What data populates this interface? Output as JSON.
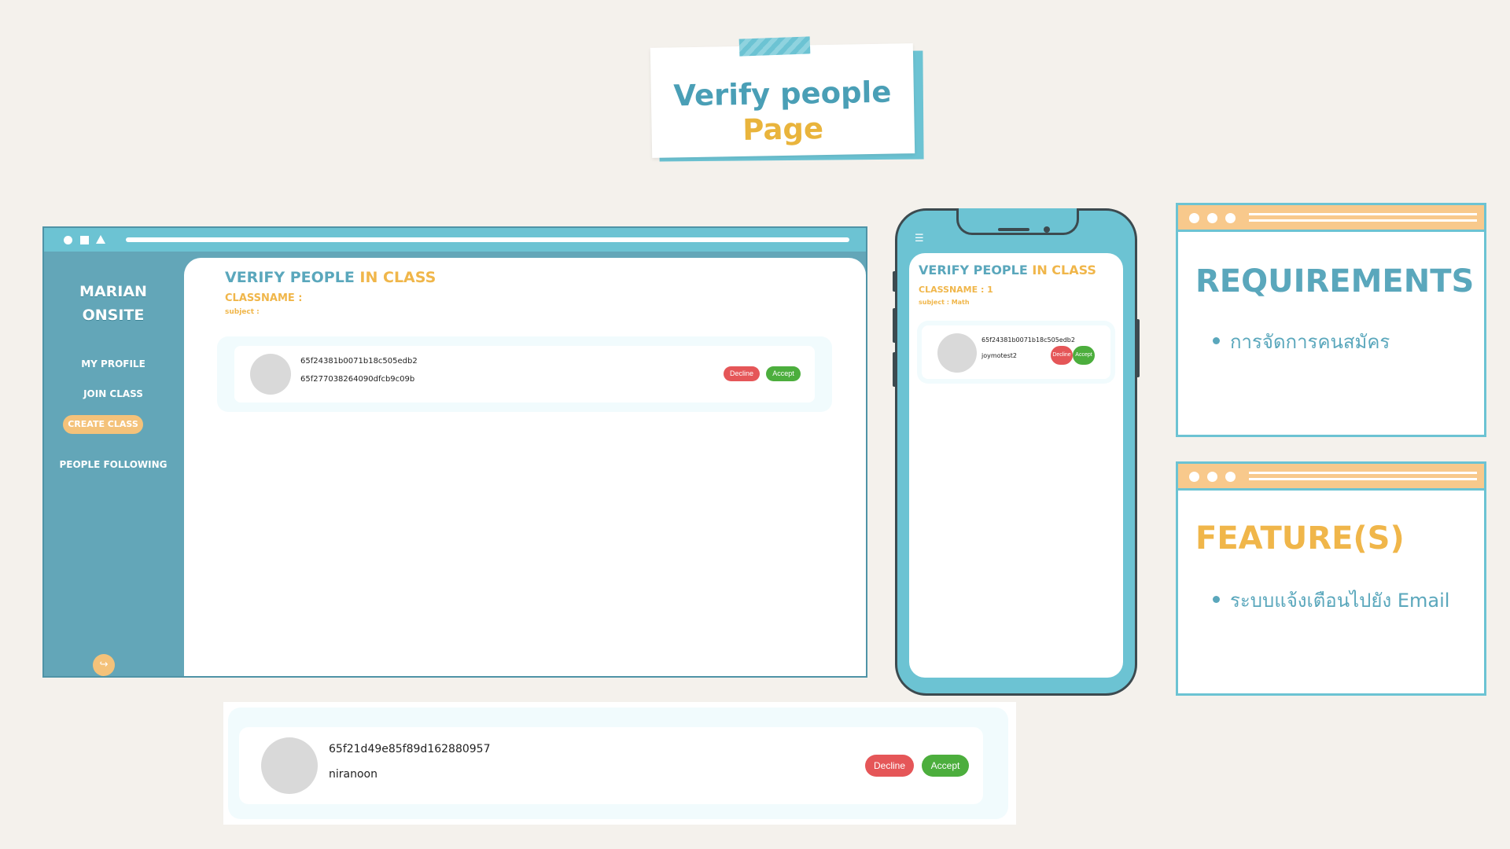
{
  "title": {
    "line1": "Verify people",
    "line2": "Page"
  },
  "desktop": {
    "brand_line1": "MARIAN",
    "brand_line2": "ONSITE",
    "nav": [
      "MY PROFILE",
      "JOIN CLASS",
      "CREATE CLASS",
      "PEOPLE FOLLOWING"
    ],
    "logout_icon": "logout-icon",
    "heading_part1": "VERIFY PEOPLE ",
    "heading_part2": "IN CLASS",
    "classname_label": "CLASSNAME :",
    "subject_label": "subject :",
    "request": {
      "id_line1": "65f24381b0071b18c505edb2",
      "id_line2": "65f277038264090dfcb9c09b",
      "decline": "Decline",
      "accept": "Accept"
    }
  },
  "phone": {
    "menu_icon": "menu-icon",
    "heading_part1": "VERIFY PEOPLE ",
    "heading_part2": "IN CLASS",
    "classname_label": "CLASSNAME : 1",
    "subject_label": "subject : Math",
    "request": {
      "id": "65f24381b0071b18c505edb2",
      "username": "joymotest2",
      "decline": "Decline",
      "accept": "Accept"
    }
  },
  "requirements": {
    "heading": "REQUIREMENTS",
    "items": [
      "การจัดการคนสมัคร"
    ]
  },
  "features": {
    "heading": "FEATURE(S)",
    "items": [
      "ระบบแจ้งเตือนไปยัง Email"
    ]
  },
  "zoom_request": {
    "id": "65f21d49e85f89d162880957",
    "username": "niranoon",
    "decline": "Decline",
    "accept": "Accept"
  },
  "colors": {
    "teal": "#6cc3d3",
    "sidebar": "#63a6b8",
    "gold": "#f0b64a",
    "peach": "#f8c98c",
    "decline": "#e55658",
    "accept": "#4cae3d",
    "background": "#f4f1ec"
  }
}
